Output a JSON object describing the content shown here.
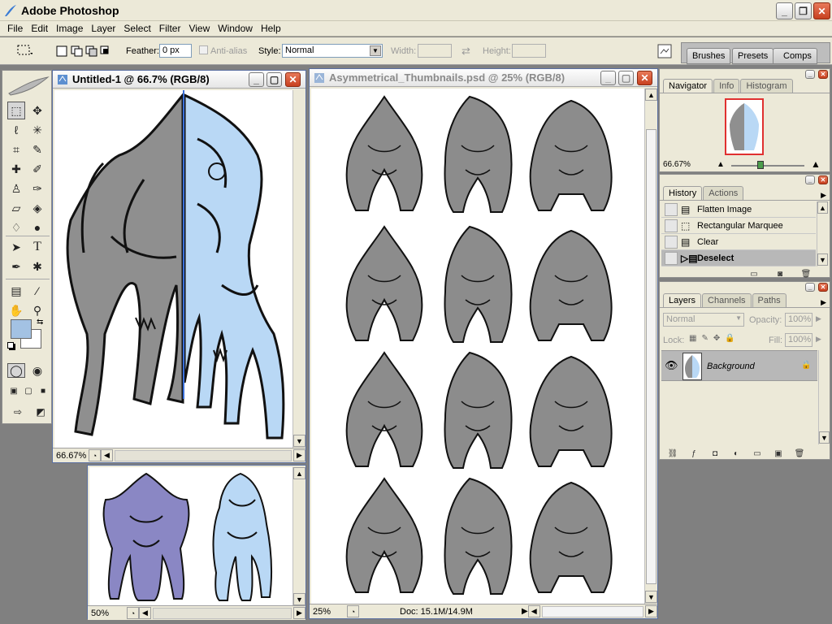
{
  "app": {
    "title": "Adobe Photoshop"
  },
  "menu": [
    "File",
    "Edit",
    "Image",
    "Layer",
    "Select",
    "Filter",
    "View",
    "Window",
    "Help"
  ],
  "options": {
    "feather_label": "Feather:",
    "feather_value": "0 px",
    "antialias_label": "Anti-alias",
    "style_label": "Style:",
    "style_value": "Normal",
    "width_label": "Width:",
    "height_label": "Height:",
    "palette_tabs": [
      "Brushes",
      "Presets",
      "Comps"
    ]
  },
  "doc1": {
    "title": "Untitled-1 @ 66.7% (RGB/8)",
    "zoom": "66.67%"
  },
  "doc2": {
    "zoom": "50%"
  },
  "doc3": {
    "title": "Asymmetrical_Thumbnails.psd @ 25% (RGB/8)",
    "zoom": "25%",
    "doc_info": "Doc: 15.1M/14.9M"
  },
  "navigator": {
    "tabs": [
      "Navigator",
      "Info",
      "Histogram"
    ],
    "zoom": "66.67%"
  },
  "history": {
    "tabs": [
      "History",
      "Actions"
    ],
    "items": [
      "Flatten Image",
      "Rectangular Marquee",
      "Clear",
      "Deselect"
    ]
  },
  "layers": {
    "tabs": [
      "Layers",
      "Channels",
      "Paths"
    ],
    "blend": "Normal",
    "opacity_label": "Opacity:",
    "opacity": "100%",
    "lock_label": "Lock:",
    "fill_label": "Fill:",
    "fill": "100%",
    "layer_name": "Background"
  },
  "colors": {
    "foreground": "#a3c2e3",
    "background": "#ffffff",
    "creature_gray": "#8c8c8c",
    "creature_blue": "#b9d8f5",
    "creature_purple": "#8a87c4"
  }
}
